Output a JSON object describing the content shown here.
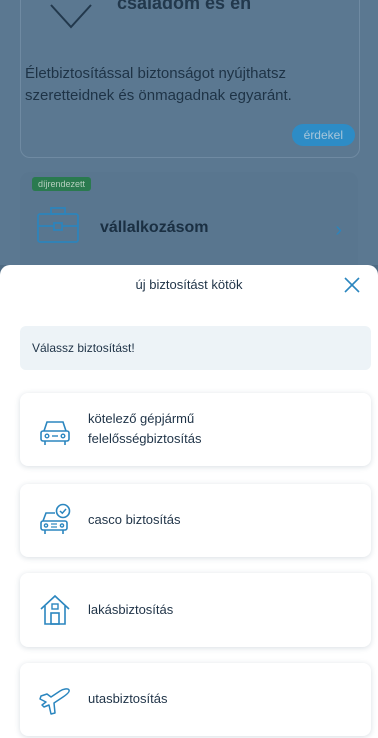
{
  "background": {
    "card1": {
      "title": "családom és én",
      "description": "Életbiztosítással biztonságot nyújthatsz szeretteidnek és önmagadnak egyaránt.",
      "button_label": "érdekel"
    },
    "card2": {
      "badge": "díjrendezett",
      "title": "vállalkozásom"
    }
  },
  "sheet": {
    "title": "új biztosítást kötök",
    "hint": "Válassz biztosítást!",
    "options": [
      {
        "line1": "kötelező gépjármű",
        "line2": "felelősségbiztosítás",
        "icon": "car-icon"
      },
      {
        "line1": "casco biztosítás",
        "icon": "car-shield-icon"
      },
      {
        "line1": "lakásbiztosítás",
        "icon": "house-icon"
      },
      {
        "line1": "utasbiztosítás",
        "icon": "airplane-icon"
      }
    ]
  },
  "colors": {
    "accent": "#2d8cc6",
    "text": "#1f3347",
    "icon": "#2b86bf"
  }
}
